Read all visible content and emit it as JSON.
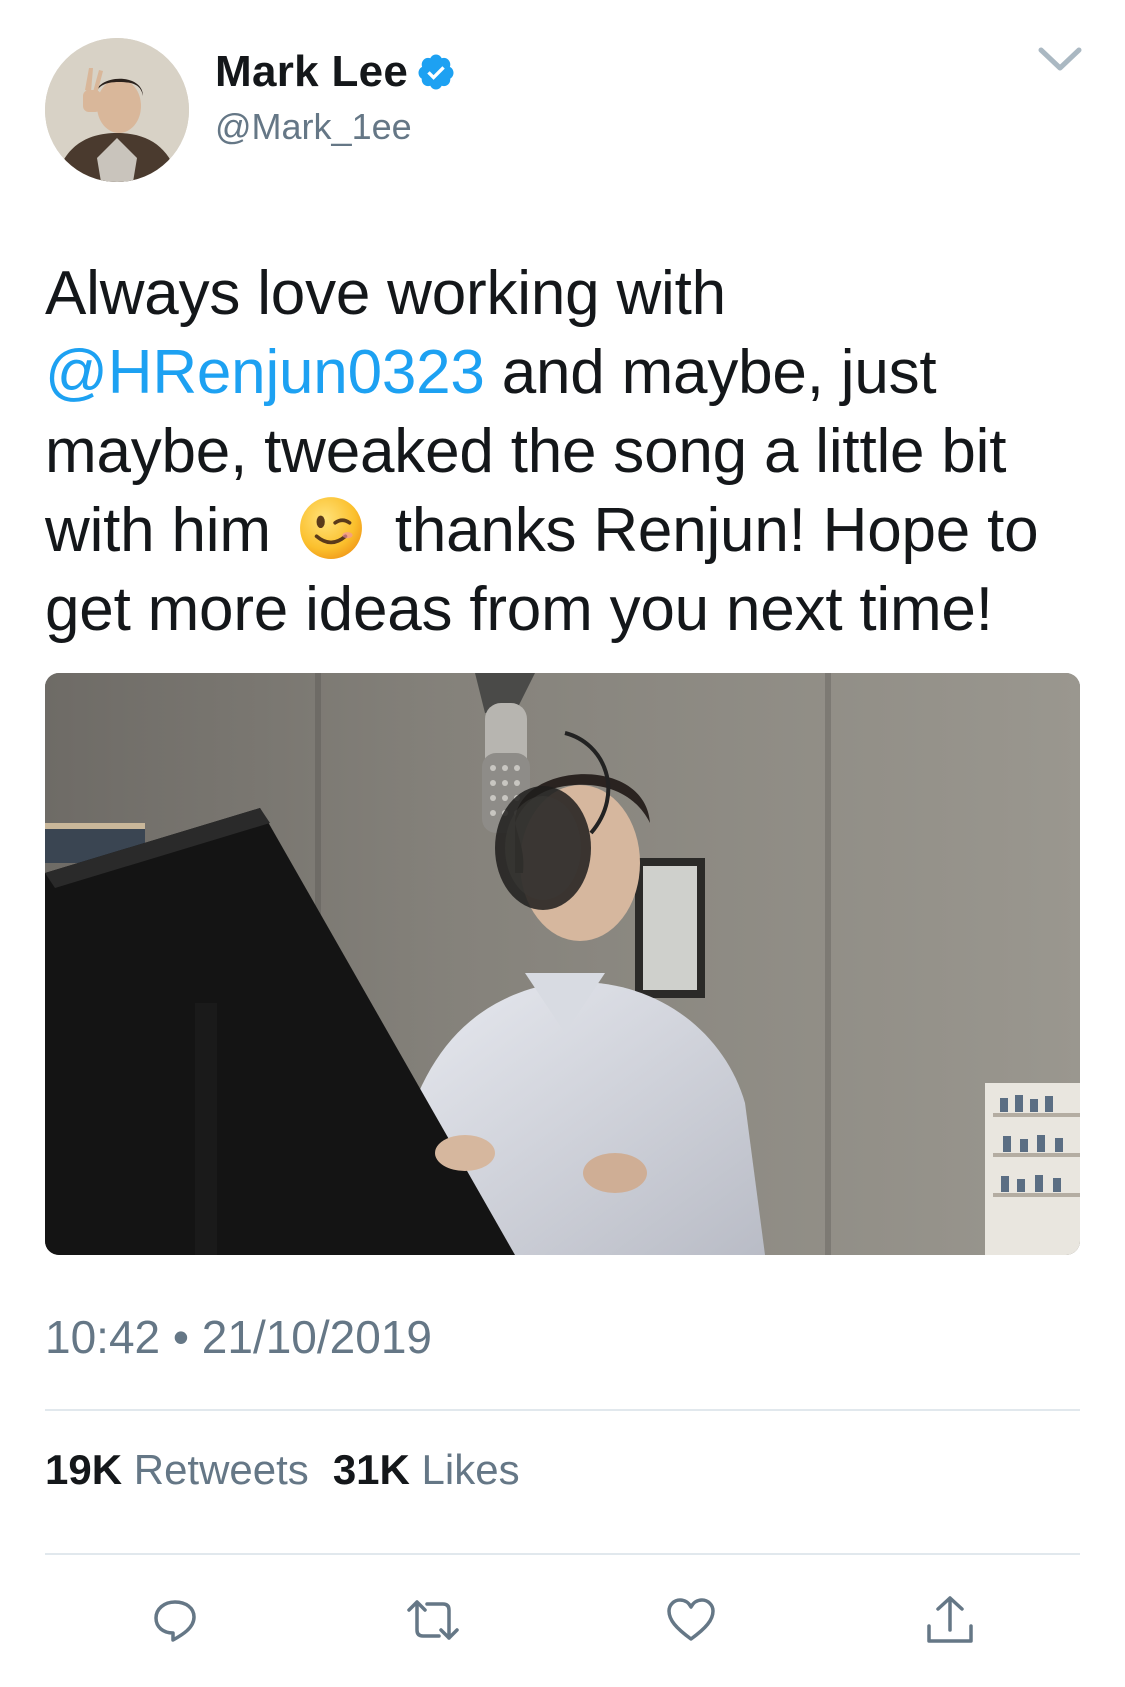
{
  "tweet": {
    "author": {
      "display_name": "Mark Lee",
      "handle": "@Mark_1ee",
      "verified": true,
      "avatar_icon": "avatar-photo"
    },
    "text_segments": [
      {
        "type": "text",
        "value": "Always love working with "
      },
      {
        "type": "mention",
        "value": "@HRenjun0323"
      },
      {
        "type": "text",
        "value": " and maybe, just maybe, tweaked the song a little bit with him "
      },
      {
        "type": "emoji",
        "value": "winking-face-emoji"
      },
      {
        "type": "text",
        "value": " thanks Renjun! Hope to get more ideas from you next time!"
      }
    ],
    "media": {
      "kind": "photo",
      "description_icon": "recording-studio-photo"
    },
    "timestamp": "10:42 • 21/10/2019",
    "stats": {
      "retweets_count": "19K",
      "retweets_label": "Retweets",
      "likes_count": "31K",
      "likes_label": "Likes"
    },
    "actions": [
      {
        "name": "reply",
        "icon": "reply-icon"
      },
      {
        "name": "retweet",
        "icon": "retweet-icon"
      },
      {
        "name": "like",
        "icon": "heart-icon"
      },
      {
        "name": "share",
        "icon": "share-icon"
      }
    ]
  },
  "colors": {
    "link": "#1da1f2",
    "verified": "#1da1f2",
    "text": "#14171a",
    "secondary": "#657786",
    "divider": "#e1e8ed"
  }
}
